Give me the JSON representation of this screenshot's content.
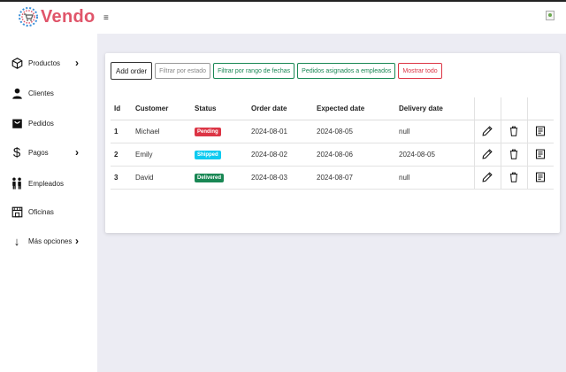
{
  "app": {
    "title": "Vendo",
    "logo_icon": "cart-logo-icon",
    "menu_icon": "≡"
  },
  "sidebar": {
    "items": [
      {
        "label": "Productos",
        "icon": "box-icon",
        "chevron": "›"
      },
      {
        "label": "Clientes",
        "icon": "person-icon"
      },
      {
        "label": "Pedidos",
        "icon": "order-bag-icon"
      },
      {
        "label": "Pagos",
        "icon": "dollar-icon",
        "glyph": "$",
        "chevron": "›"
      },
      {
        "label": "Empleados",
        "icon": "people-icon"
      },
      {
        "label": "Oficinas",
        "icon": "store-icon"
      },
      {
        "label": "Más opciones",
        "icon": "arrow-down-icon",
        "glyph": "↓",
        "chevron": "›"
      }
    ]
  },
  "toolbar": {
    "add_order": "Add order",
    "filter_status": "Filtrar por estado",
    "filter_dates": "Filtrar por rango de fechas",
    "assigned_employees": "Pedidos asignados a empleados",
    "show_all": "Mostrar todo"
  },
  "table": {
    "headers": [
      "Id",
      "Customer",
      "Status",
      "Order date",
      "Expected date",
      "Delivery date"
    ],
    "rows": [
      {
        "id": "1",
        "customer": "Michael",
        "status": "Pending",
        "status_color": "#dc3545",
        "order_date": "2024-08-01",
        "expected_date": "2024-08-05",
        "delivery_date": "null"
      },
      {
        "id": "2",
        "customer": "Emily",
        "status": "Shipped",
        "status_color": "#0dcaf0",
        "order_date": "2024-08-02",
        "expected_date": "2024-08-06",
        "delivery_date": "2024-08-05"
      },
      {
        "id": "3",
        "customer": "David",
        "status": "Delivered",
        "status_color": "#198754",
        "order_date": "2024-08-03",
        "expected_date": "2024-08-07",
        "delivery_date": "null"
      }
    ],
    "action_icons": [
      "pencil-icon",
      "trash-icon",
      "details-icon"
    ]
  },
  "colors": {
    "brand": "#e0556a",
    "main_bg": "#ececf3"
  }
}
